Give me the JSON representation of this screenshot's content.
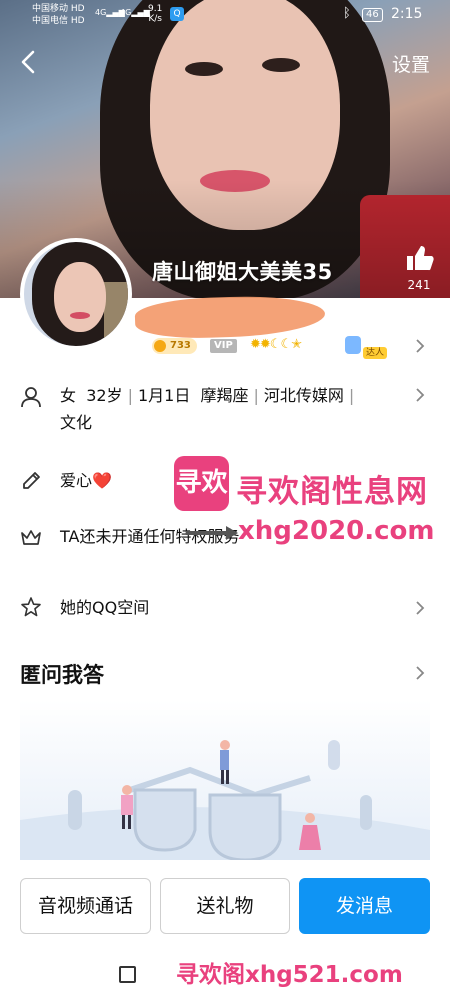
{
  "status_bar": {
    "carrier_1": "中国移动",
    "carrier_2": "中国电信",
    "hd_tag": "HD",
    "net_1": "4G",
    "net_2": "4G",
    "speed_value": "9.1",
    "speed_unit": "K/s",
    "battery": "46",
    "time": "2:15"
  },
  "header": {
    "back_icon": "chevron-left-icon",
    "settings_label": "设置"
  },
  "profile": {
    "nickname": "唐山御姐大美美35",
    "like_count": "241",
    "coin_value": "733",
    "vip_label": "VIP",
    "talent_label": "达人"
  },
  "info": {
    "gender": "女",
    "age": "32岁",
    "birthday": "1月1日",
    "zodiac": "摩羯座",
    "company": "河北传媒网",
    "occupation": "文化",
    "hobby": "爱心",
    "heart_glyph": "❤️",
    "privilege_text": "TA还未开通任何特权服务",
    "qzone_text": "她的QQ空间"
  },
  "section": {
    "qa_title": "匿问我答"
  },
  "watermark": {
    "logo_text": "寻欢",
    "title": "寻欢阁性息网",
    "url": "xhg2020.com",
    "bottom": "寻欢阁xhg521.com"
  },
  "actions": {
    "call_label": "音视频通话",
    "gift_label": "送礼物",
    "message_label": "发消息"
  },
  "colors": {
    "accent": "#0f94f4",
    "watermark": "#e9417e",
    "coin": "#f5a814"
  }
}
